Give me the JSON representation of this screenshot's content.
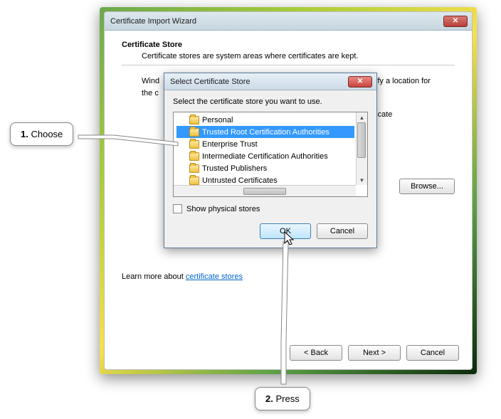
{
  "wizard": {
    "title": "Certificate Import Wizard",
    "heading": "Certificate Store",
    "subheading": "Certificate stores are system areas where certificates are kept.",
    "body_line1_prefix": "Wind",
    "body_line1_suffix": "pecify a location for",
    "body_line2": "the c",
    "radio2_suffix": "of certificate",
    "browse_label": "Browse...",
    "learn_prefix": "Learn more about ",
    "learn_link": "certificate stores",
    "back_label": "< Back",
    "next_label": "Next >",
    "cancel_label": "Cancel"
  },
  "dialog": {
    "title": "Select Certificate Store",
    "prompt": "Select the certificate store you want to use.",
    "items": [
      "Personal",
      "Trusted Root Certification Authorities",
      "Enterprise Trust",
      "Intermediate Certification Authorities",
      "Trusted Publishers",
      "Untrusted Certificates"
    ],
    "selected_index": 1,
    "show_physical_label": "Show physical stores",
    "ok_label": "OK",
    "cancel_label": "Cancel"
  },
  "annotations": {
    "choose_num": "1.",
    "choose_text": "Choose",
    "press_num": "2.",
    "press_text": "Press"
  }
}
